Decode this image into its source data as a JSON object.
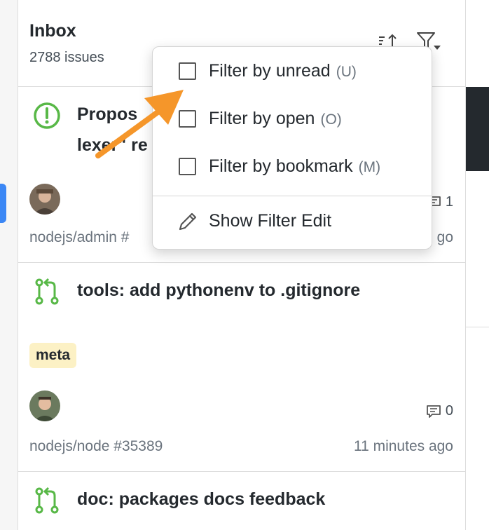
{
  "inbox": {
    "title": "Inbox",
    "count": "2788 issues",
    "sort_icon": "sort-icon",
    "filter_icon": "filter-icon"
  },
  "filter_menu": {
    "items": [
      {
        "label": "Filter by unread",
        "shortcut": "(U)",
        "checked": false
      },
      {
        "label": "Filter by open",
        "shortcut": "(O)",
        "checked": false
      },
      {
        "label": "Filter by bookmark",
        "shortcut": "(M)",
        "checked": false
      }
    ],
    "edit": {
      "label": "Show Filter Edit",
      "icon": "pencil-icon"
    }
  },
  "issues": [
    {
      "type": "issue-open",
      "title_line1": "Propos",
      "title_line2": "lexer\" re",
      "comments": "1",
      "repo": "nodejs/admin #",
      "time": "go"
    },
    {
      "type": "pull-request",
      "title": "tools: add pythonenv to .gitignore",
      "label": "meta",
      "comments": "0",
      "repo": "nodejs/node #35389",
      "time": "11 minutes ago"
    },
    {
      "type": "pull-request",
      "title": "doc: packages docs feedback"
    }
  ],
  "colors": {
    "accent_blue": "#3b87f5",
    "open_green": "#58b847",
    "label_bg": "#fcf1c5",
    "annotation_orange": "#f5962a"
  }
}
